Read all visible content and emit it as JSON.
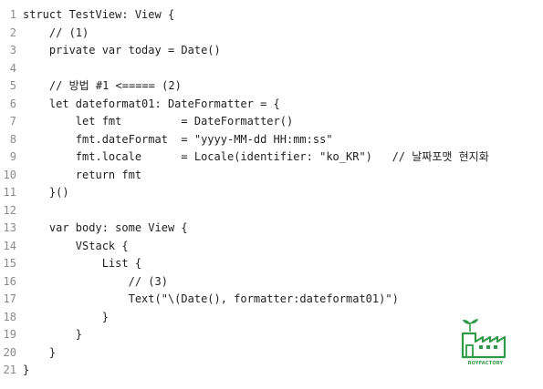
{
  "code": {
    "lines": [
      {
        "number": "1",
        "text": "struct TestView: View {"
      },
      {
        "number": "2",
        "text": "    // (1)"
      },
      {
        "number": "3",
        "text": "    private var today = Date()"
      },
      {
        "number": "4",
        "text": ""
      },
      {
        "number": "5",
        "text": "    // 방법 #1 <===== (2)"
      },
      {
        "number": "6",
        "text": "    let dateformat01: DateFormatter = {"
      },
      {
        "number": "7",
        "text": "        let fmt         = DateFormatter()"
      },
      {
        "number": "8",
        "text": "        fmt.dateFormat  = \"yyyy-MM-dd HH:mm:ss\""
      },
      {
        "number": "9",
        "text": "        fmt.locale      = Locale(identifier: \"ko_KR\")   // 날짜포맷 현지화"
      },
      {
        "number": "10",
        "text": "        return fmt"
      },
      {
        "number": "11",
        "text": "    }()"
      },
      {
        "number": "12",
        "text": ""
      },
      {
        "number": "13",
        "text": "    var body: some View {"
      },
      {
        "number": "14",
        "text": "        VStack {"
      },
      {
        "number": "15",
        "text": "            List {"
      },
      {
        "number": "16",
        "text": "                // (3)"
      },
      {
        "number": "17",
        "text": "                Text(\"\\(Date(), formatter:dateformat01)\")"
      },
      {
        "number": "18",
        "text": "            }"
      },
      {
        "number": "19",
        "text": "        }"
      },
      {
        "number": "20",
        "text": "    }"
      },
      {
        "number": "21",
        "text": "}"
      }
    ]
  },
  "logo": {
    "icon": "factory-sprout-logo",
    "text": "ROYFACTORY",
    "color": "#2f9a46"
  }
}
